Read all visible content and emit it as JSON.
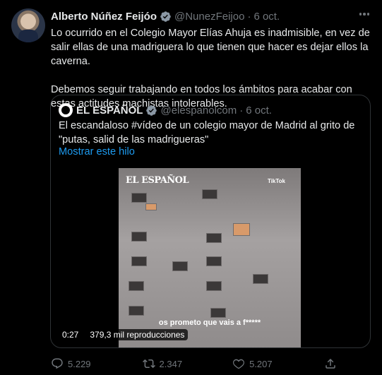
{
  "tweet": {
    "author_name": "Alberto Núñez Feijóo",
    "handle": "@NunezFeijoo",
    "separator": "·",
    "date": "6 oct.",
    "paragraph1": "Lo ocurrido en el Colegio Mayor Elías Ahuja es inadmisible, en vez de salir ellas de una madriguera lo que tienen que hacer es dejar ellos la caverna.",
    "paragraph2": "Debemos seguir trabajando en todos los ámbitos para acabar con estas actitudes machistas intolerables."
  },
  "quote": {
    "author_name": "EL ESPAÑOL",
    "handle": "@elespanolcom",
    "separator": "·",
    "date": "6 oct.",
    "text": "El escandaloso #vídeo de un colegio mayor de Madrid al grito de \"putas, salid de las madrigueras\"",
    "show_thread": "Mostrar este hilo",
    "video": {
      "watermark_logo": "EL ESPAÑOL",
      "watermark_tiktok": "TikTok",
      "caption": "os prometo que vais a f*****",
      "duration": "0:27",
      "views": "379,3 mil reproducciones"
    }
  },
  "actions": {
    "replies": "5.229",
    "retweets": "2.347",
    "likes": "5.207"
  },
  "colors": {
    "background": "#000000",
    "text": "#e7e9ea",
    "secondary": "#71767b",
    "link": "#1d9bf0",
    "verified": "#8b98a5"
  },
  "icons": [
    "more-icon",
    "verified-icon",
    "reply-icon",
    "retweet-icon",
    "like-icon",
    "share-icon"
  ]
}
